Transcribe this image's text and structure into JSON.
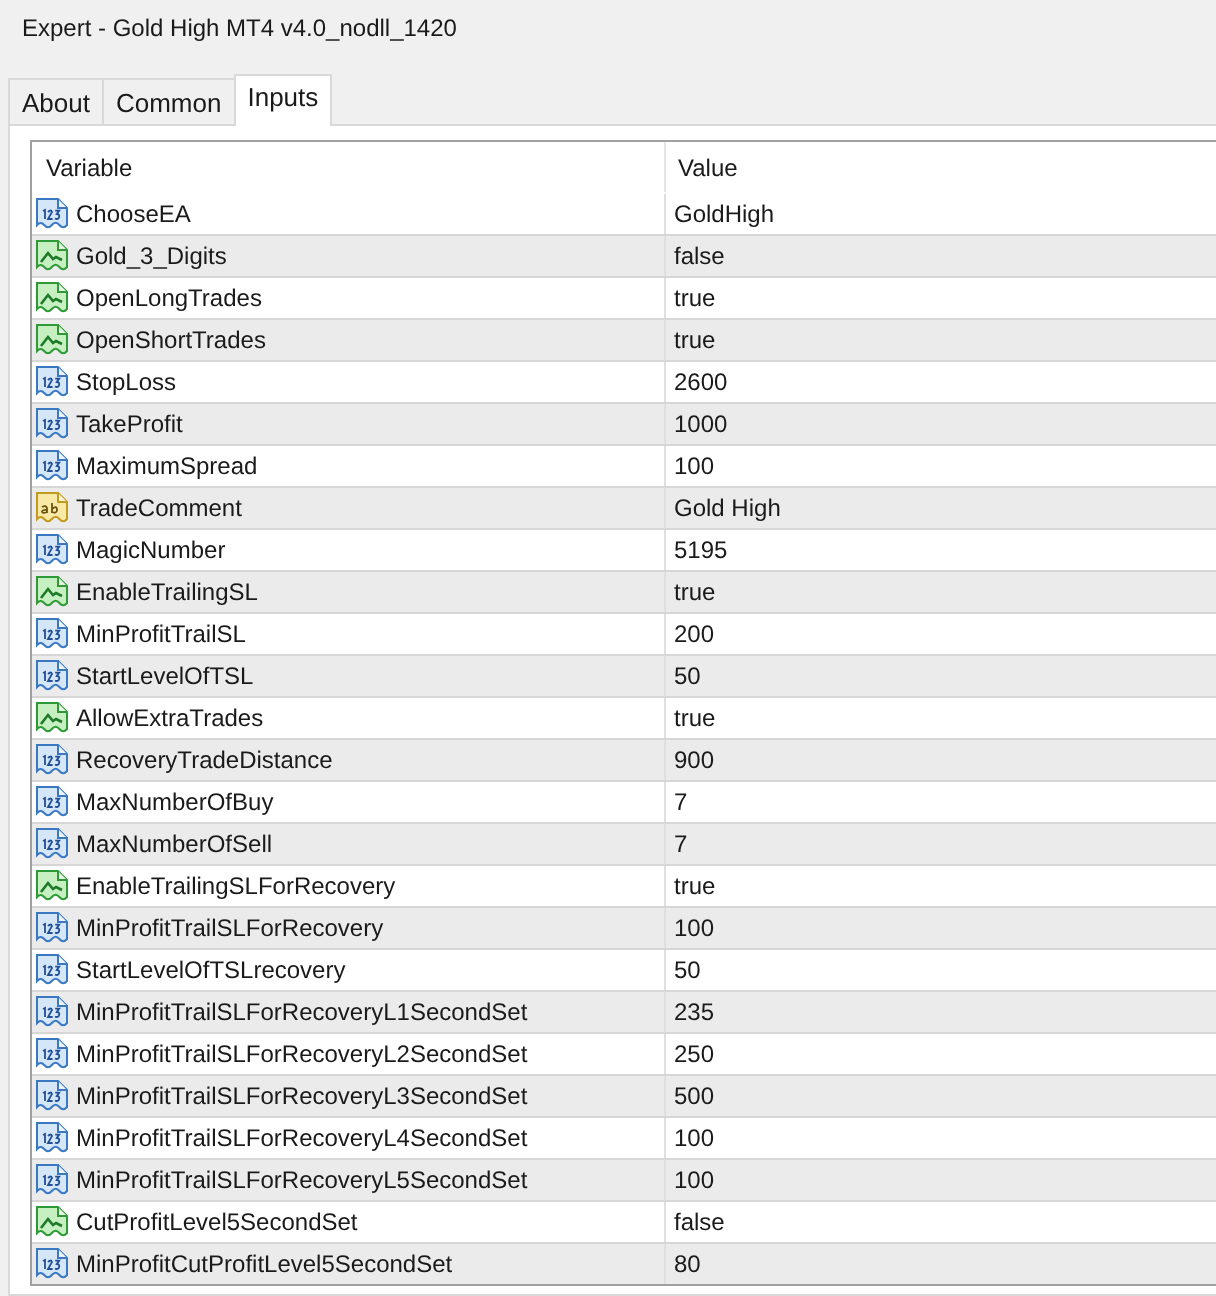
{
  "window": {
    "title": "Expert - Gold High MT4 v4.0_nodll_1420"
  },
  "tabs": [
    {
      "label": "About",
      "selected": false
    },
    {
      "label": "Common",
      "selected": false
    },
    {
      "label": "Inputs",
      "selected": true
    }
  ],
  "table": {
    "columns": [
      "Variable",
      "Value"
    ],
    "rows": [
      {
        "kind": "int",
        "variable": "ChooseEA",
        "value": "GoldHigh"
      },
      {
        "kind": "bool",
        "variable": "Gold_3_Digits",
        "value": "false"
      },
      {
        "kind": "bool",
        "variable": "OpenLongTrades",
        "value": "true"
      },
      {
        "kind": "bool",
        "variable": "OpenShortTrades",
        "value": "true"
      },
      {
        "kind": "int",
        "variable": "StopLoss",
        "value": "2600"
      },
      {
        "kind": "int",
        "variable": "TakeProfit",
        "value": "1000"
      },
      {
        "kind": "int",
        "variable": "MaximumSpread",
        "value": "100"
      },
      {
        "kind": "string",
        "variable": "TradeComment",
        "value": "Gold High"
      },
      {
        "kind": "int",
        "variable": "MagicNumber",
        "value": "5195"
      },
      {
        "kind": "bool",
        "variable": "EnableTrailingSL",
        "value": "true"
      },
      {
        "kind": "int",
        "variable": "MinProfitTrailSL",
        "value": "200"
      },
      {
        "kind": "int",
        "variable": "StartLevelOfTSL",
        "value": "50"
      },
      {
        "kind": "bool",
        "variable": "AllowExtraTrades",
        "value": "true"
      },
      {
        "kind": "int",
        "variable": "RecoveryTradeDistance",
        "value": "900"
      },
      {
        "kind": "int",
        "variable": "MaxNumberOfBuy",
        "value": "7"
      },
      {
        "kind": "int",
        "variable": "MaxNumberOfSell",
        "value": "7"
      },
      {
        "kind": "bool",
        "variable": "EnableTrailingSLForRecovery",
        "value": "true"
      },
      {
        "kind": "int",
        "variable": "MinProfitTrailSLForRecovery",
        "value": "100"
      },
      {
        "kind": "int",
        "variable": "StartLevelOfTSLrecovery",
        "value": "50"
      },
      {
        "kind": "int",
        "variable": "MinProfitTrailSLForRecoveryL1SecondSet",
        "value": "235"
      },
      {
        "kind": "int",
        "variable": "MinProfitTrailSLForRecoveryL2SecondSet",
        "value": "250"
      },
      {
        "kind": "int",
        "variable": "MinProfitTrailSLForRecoveryL3SecondSet",
        "value": "500"
      },
      {
        "kind": "int",
        "variable": "MinProfitTrailSLForRecoveryL4SecondSet",
        "value": "100"
      },
      {
        "kind": "int",
        "variable": "MinProfitTrailSLForRecoveryL5SecondSet",
        "value": "100"
      },
      {
        "kind": "bool",
        "variable": "CutProfitLevel5SecondSet",
        "value": "false"
      },
      {
        "kind": "int",
        "variable": "MinProfitCutProfitLevel5SecondSet",
        "value": "80"
      }
    ]
  }
}
